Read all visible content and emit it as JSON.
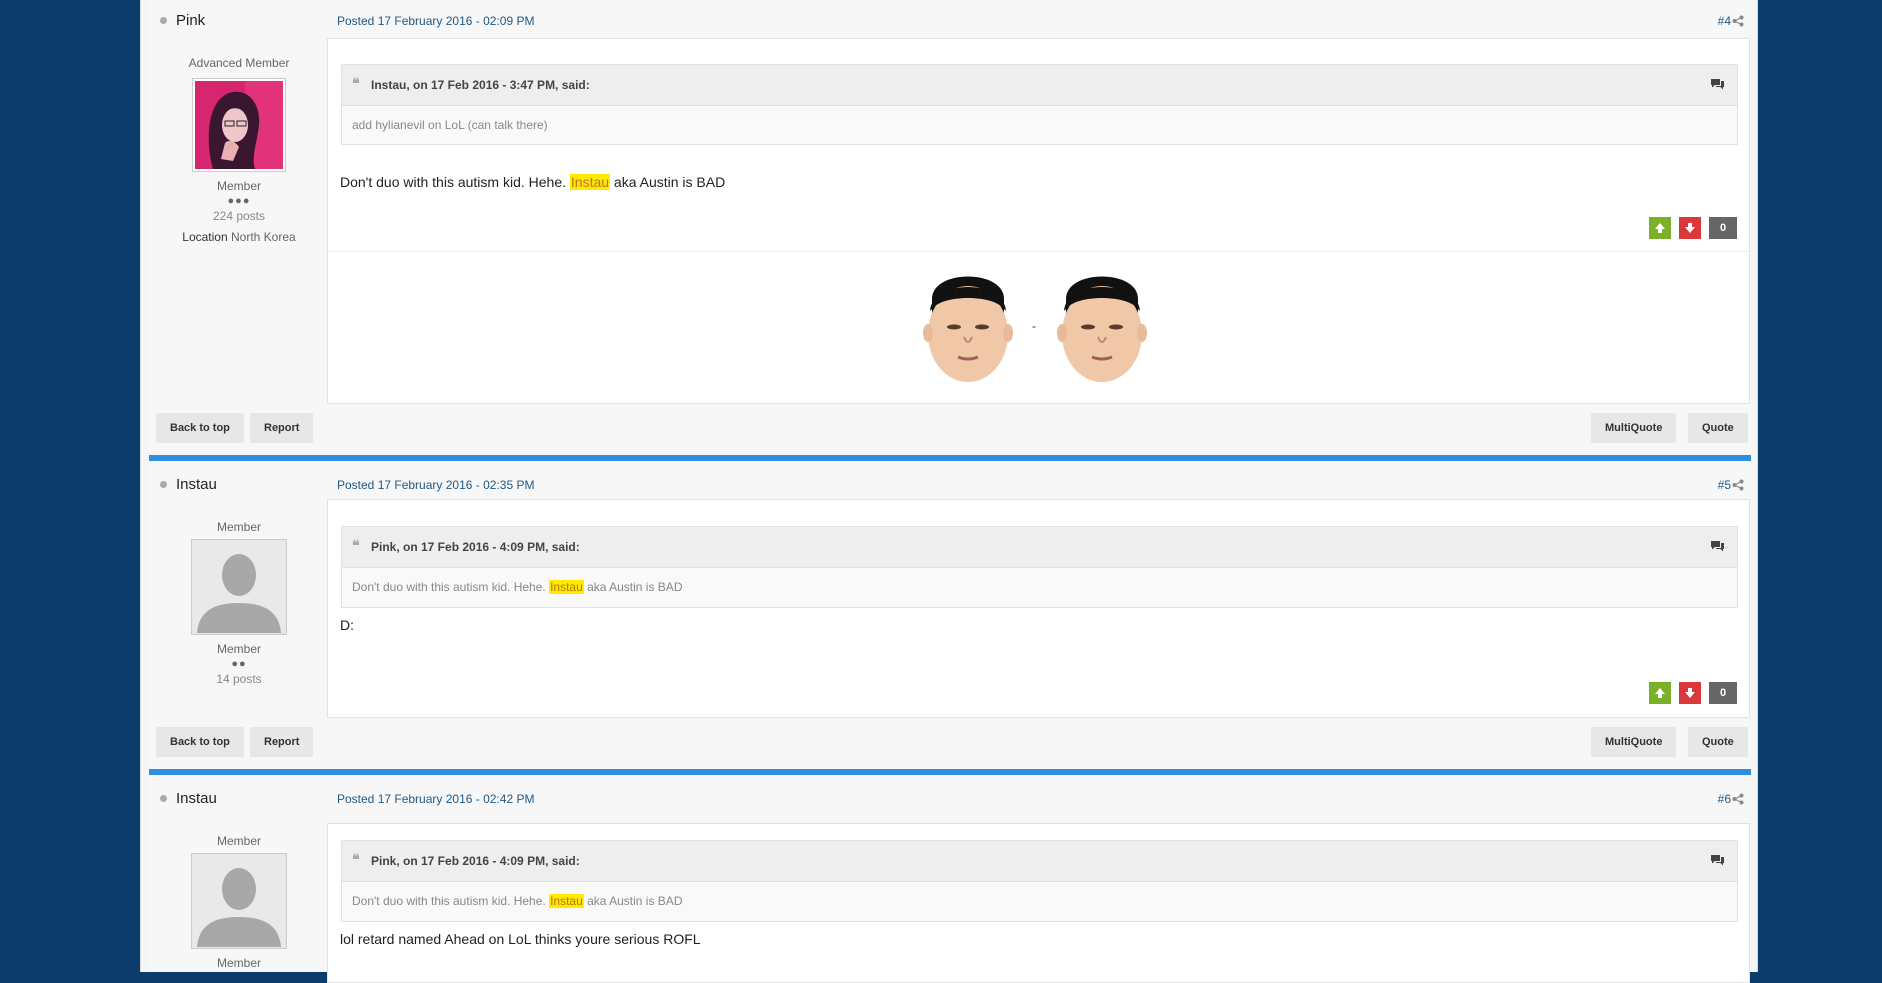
{
  "posts": [
    {
      "author": "Pink",
      "posted": "Posted 17 February 2016 - 02:09 PM",
      "post_number": "#4",
      "rank_title": "Advanced Member",
      "group": "Member",
      "pips": "●●●",
      "post_count": "224 posts",
      "location_label": "Location",
      "location_value": "North Korea",
      "quote_header": "Instau, on 17 Feb 2016 - 3:47 PM, said:",
      "quote_text": "add hylianevil on LoL (can talk there)",
      "body_before": "Don't duo with this autism kid. Hehe. ",
      "body_highlight": "Instau",
      "body_after": " aka Austin is BAD",
      "reputation": "0",
      "signature_sep": "-",
      "buttons": {
        "back_to_top": "Back to top",
        "report": "Report",
        "multiquote": "MultiQuote",
        "quote": "Quote"
      }
    },
    {
      "author": "Instau",
      "posted": "Posted 17 February 2016 - 02:35 PM",
      "post_number": "#5",
      "rank_title": "Member",
      "group": "Member",
      "pips": "●●",
      "post_count": "14 posts",
      "quote_header": "Pink, on 17 Feb 2016 - 4:09 PM, said:",
      "quote_before": "Don't duo with this autism kid. Hehe. ",
      "quote_highlight": "Instau",
      "quote_after": " aka Austin is BAD",
      "body": "D:",
      "reputation": "0",
      "buttons": {
        "back_to_top": "Back to top",
        "report": "Report",
        "multiquote": "MultiQuote",
        "quote": "Quote"
      }
    },
    {
      "author": "Instau",
      "posted": "Posted 17 February 2016 - 02:42 PM",
      "post_number": "#6",
      "rank_title": "Member",
      "group": "Member",
      "quote_header": "Pink, on 17 Feb 2016 - 4:09 PM, said:",
      "quote_before": "Don't duo with this autism kid. Hehe. ",
      "quote_highlight": "Instau",
      "quote_after": " aka Austin is BAD",
      "body": "lol retard named Ahead on LoL thinks youre serious ROFL"
    }
  ],
  "colors": {
    "background": "#0c3c6a",
    "divider": "#2e8fde",
    "link": "#225985",
    "highlight": "#ffea00"
  }
}
